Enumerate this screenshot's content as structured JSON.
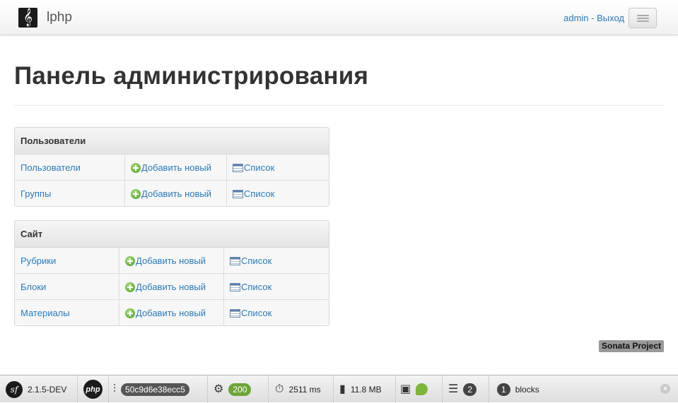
{
  "navbar": {
    "brand_logo": "𝄞",
    "brand": "lphp",
    "user": "admin",
    "separator": " - ",
    "logout": "Выход",
    "menu_icon": "hamburger-icon"
  },
  "page": {
    "title": "Панель администрирования"
  },
  "groups": [
    {
      "title": "Пользователи",
      "rows": [
        {
          "name": "Пользователи",
          "add": "Добавить новый",
          "list": "Список"
        },
        {
          "name": "Группы",
          "add": "Добавить новый",
          "list": "Список"
        }
      ]
    },
    {
      "title": "Сайт",
      "rows": [
        {
          "name": "Рубрики",
          "add": "Добавить новый",
          "list": "Список"
        },
        {
          "name": "Блоки",
          "add": "Добавить новый",
          "list": "Список"
        },
        {
          "name": "Материалы",
          "add": "Добавить новый",
          "list": "Список"
        }
      ]
    }
  ],
  "footer": {
    "badge": "Sonata Project"
  },
  "toolbar": {
    "sf_logo": "sf",
    "version": "2.1.5-DEV",
    "php_logo": "php",
    "token": "50c9d6e38ecc5",
    "status": "200",
    "time": "2511 ms",
    "memory": "11.8 MB",
    "db_queries": "2",
    "blocks_count": "1",
    "blocks_label": "blocks",
    "close": "×"
  },
  "colors": {
    "link": "#2a7ab8",
    "status_ok": "#6da43a"
  }
}
